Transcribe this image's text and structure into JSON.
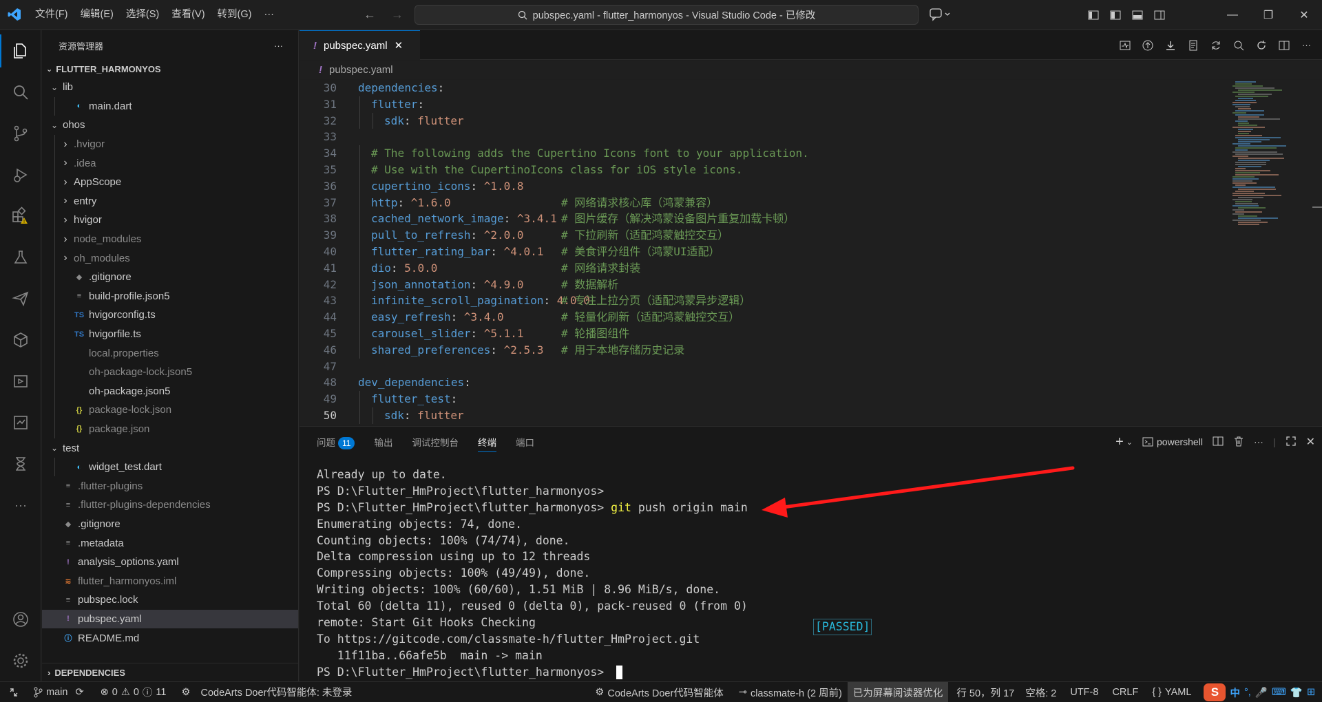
{
  "titlebar": {
    "menus": [
      "文件(F)",
      "编辑(E)",
      "选择(S)",
      "查看(V)",
      "转到(G)",
      "···"
    ],
    "search": "pubspec.yaml - flutter_harmonyos - Visual Studio Code - 已修改"
  },
  "sidebar": {
    "title": "资源管理器",
    "more": "···",
    "root": "FLUTTER_HARMONYOS",
    "items": [
      {
        "label": "lib",
        "depth": 0,
        "kind": "folder-open",
        "icon": ""
      },
      {
        "label": "main.dart",
        "depth": 1,
        "kind": "file",
        "icon": "dart"
      },
      {
        "label": "ohos",
        "depth": 0,
        "kind": "folder-open",
        "icon": ""
      },
      {
        "label": ".hvigor",
        "depth": 1,
        "kind": "folder",
        "icon": "",
        "dim": true
      },
      {
        "label": ".idea",
        "depth": 1,
        "kind": "folder",
        "icon": "",
        "dim": true
      },
      {
        "label": "AppScope",
        "depth": 1,
        "kind": "folder",
        "icon": ""
      },
      {
        "label": "entry",
        "depth": 1,
        "kind": "folder",
        "icon": ""
      },
      {
        "label": "hvigor",
        "depth": 1,
        "kind": "folder",
        "icon": ""
      },
      {
        "label": "node_modules",
        "depth": 1,
        "kind": "folder",
        "icon": "",
        "dim": true
      },
      {
        "label": "oh_modules",
        "depth": 1,
        "kind": "folder",
        "icon": "",
        "dim": true
      },
      {
        "label": ".gitignore",
        "depth": 1,
        "kind": "file",
        "icon": "git"
      },
      {
        "label": "build-profile.json5",
        "depth": 1,
        "kind": "file",
        "icon": "lines"
      },
      {
        "label": "hvigorconfig.ts",
        "depth": 1,
        "kind": "file",
        "icon": "ts"
      },
      {
        "label": "hvigorfile.ts",
        "depth": 1,
        "kind": "file",
        "icon": "ts"
      },
      {
        "label": "local.properties",
        "depth": 1,
        "kind": "file",
        "icon": "",
        "dim": true
      },
      {
        "label": "oh-package-lock.json5",
        "depth": 1,
        "kind": "file",
        "icon": "",
        "dim": true
      },
      {
        "label": "oh-package.json5",
        "depth": 1,
        "kind": "file",
        "icon": ""
      },
      {
        "label": "package-lock.json",
        "depth": 1,
        "kind": "file",
        "icon": "json",
        "dim": true
      },
      {
        "label": "package.json",
        "depth": 1,
        "kind": "file",
        "icon": "json",
        "dim": true
      },
      {
        "label": "test",
        "depth": 0,
        "kind": "folder-open",
        "icon": ""
      },
      {
        "label": "widget_test.dart",
        "depth": 1,
        "kind": "file",
        "icon": "dart"
      },
      {
        "label": ".flutter-plugins",
        "depth": 0,
        "kind": "file",
        "icon": "lines",
        "dim": true
      },
      {
        "label": ".flutter-plugins-dependencies",
        "depth": 0,
        "kind": "file",
        "icon": "lines",
        "dim": true
      },
      {
        "label": ".gitignore",
        "depth": 0,
        "kind": "file",
        "icon": "git"
      },
      {
        "label": ".metadata",
        "depth": 0,
        "kind": "file",
        "icon": "lines"
      },
      {
        "label": "analysis_options.yaml",
        "depth": 0,
        "kind": "file",
        "icon": "yaml"
      },
      {
        "label": "flutter_harmonyos.iml",
        "depth": 0,
        "kind": "file",
        "icon": "rss",
        "dim": true
      },
      {
        "label": "pubspec.lock",
        "depth": 0,
        "kind": "file",
        "icon": "lines"
      },
      {
        "label": "pubspec.yaml",
        "depth": 0,
        "kind": "file",
        "icon": "yaml",
        "selected": true
      },
      {
        "label": "README.md",
        "depth": 0,
        "kind": "file",
        "icon": "info"
      }
    ],
    "dependencies": "DEPENDENCIES"
  },
  "editor": {
    "tab": "pubspec.yaml",
    "breadcrumb": "pubspec.yaml",
    "lines": [
      {
        "n": "30",
        "indent": 0,
        "key": "dependencies",
        "val": "",
        "comment": ""
      },
      {
        "n": "31",
        "indent": 1,
        "key": "flutter",
        "val": "",
        "comment": ""
      },
      {
        "n": "32",
        "indent": 2,
        "key": "sdk",
        "val": "flutter",
        "comment": ""
      },
      {
        "n": "33",
        "indent": 0,
        "key": "",
        "val": "",
        "comment": ""
      },
      {
        "n": "34",
        "indent": 1,
        "key": "",
        "val": "",
        "comment": "# The following adds the Cupertino Icons font to your application."
      },
      {
        "n": "35",
        "indent": 1,
        "key": "",
        "val": "",
        "comment": "# Use with the CupertinoIcons class for iOS style icons."
      },
      {
        "n": "36",
        "indent": 1,
        "key": "cupertino_icons",
        "val": "^1.0.8",
        "comment": ""
      },
      {
        "n": "37",
        "indent": 1,
        "key": "http",
        "val": "^1.6.0",
        "comment": "# 网络请求核心库（鸿蒙兼容）"
      },
      {
        "n": "38",
        "indent": 1,
        "key": "cached_network_image",
        "val": "^3.4.1",
        "comment": "# 图片缓存（解决鸿蒙设备图片重复加载卡顿）"
      },
      {
        "n": "39",
        "indent": 1,
        "key": "pull_to_refresh",
        "val": "^2.0.0",
        "comment": "# 下拉刷新（适配鸿蒙触控交互）"
      },
      {
        "n": "40",
        "indent": 1,
        "key": "flutter_rating_bar",
        "val": "^4.0.1",
        "comment": "# 美食评分组件（鸿蒙UI适配）"
      },
      {
        "n": "41",
        "indent": 1,
        "key": "dio",
        "val": "5.0.0",
        "comment": "# 网络请求封装"
      },
      {
        "n": "42",
        "indent": 1,
        "key": "json_annotation",
        "val": "^4.9.0",
        "comment": "# 数据解析"
      },
      {
        "n": "43",
        "indent": 1,
        "key": "infinite_scroll_pagination",
        "val": "4.0.0",
        "comment": "# 专注上拉分页（适配鸿蒙异步逻辑）"
      },
      {
        "n": "44",
        "indent": 1,
        "key": "easy_refresh",
        "val": "^3.4.0",
        "comment": "# 轻量化刷新（适配鸿蒙触控交互）"
      },
      {
        "n": "45",
        "indent": 1,
        "key": "carousel_slider",
        "val": "^5.1.1",
        "comment": "# 轮播图组件"
      },
      {
        "n": "46",
        "indent": 1,
        "key": "shared_preferences",
        "val": "^2.5.3",
        "comment": "# 用于本地存储历史记录"
      },
      {
        "n": "47",
        "indent": 0,
        "key": "",
        "val": "",
        "comment": ""
      },
      {
        "n": "48",
        "indent": 0,
        "key": "dev_dependencies",
        "val": "",
        "comment": ""
      },
      {
        "n": "49",
        "indent": 1,
        "key": "flutter_test",
        "val": "",
        "comment": ""
      },
      {
        "n": "50",
        "indent": 2,
        "key": "sdk",
        "val": "flutter",
        "comment": ""
      }
    ]
  },
  "panel": {
    "tabs": [
      "问题",
      "输出",
      "调试控制台",
      "终端",
      "端口"
    ],
    "problems_count": "11",
    "active_tab": "终端",
    "shell": "powershell",
    "terminal": [
      {
        "text": "Already up to date.",
        "cmd": ""
      },
      {
        "text": "PS D:\\Flutter_HmProject\\flutter_harmonyos> ",
        "cmd": ""
      },
      {
        "text": "PS D:\\Flutter_HmProject\\flutter_harmonyos> ",
        "cmd": "git",
        "rest": " push origin main"
      },
      {
        "text": "Enumerating objects: 74, done.",
        "cmd": ""
      },
      {
        "text": "Counting objects: 100% (74/74), done.",
        "cmd": ""
      },
      {
        "text": "Delta compression using up to 12 threads",
        "cmd": ""
      },
      {
        "text": "Compressing objects: 100% (49/49), done.",
        "cmd": ""
      },
      {
        "text": "Writing objects: 100% (60/60), 1.51 MiB | 8.96 MiB/s, done.",
        "cmd": ""
      },
      {
        "text": "Total 60 (delta 11), reused 0 (delta 0), pack-reused 0 (from 0)",
        "cmd": ""
      },
      {
        "text": "remote: Start Git Hooks Checking",
        "cmd": ""
      },
      {
        "text": "To https://gitcode.com/classmate-h/flutter_HmProject.git",
        "cmd": ""
      },
      {
        "text": "   11f11ba..66afe5b  main -> main",
        "cmd": ""
      },
      {
        "text": "PS D:\\Flutter_HmProject\\flutter_harmonyos> ",
        "cmd": "",
        "cursor": true
      }
    ],
    "passed": "[PASSED]",
    "annotation_color": "#ff1a1a"
  },
  "statusbar": {
    "branch": "main",
    "errors": "0",
    "warnings": "0",
    "infos": "11",
    "codearts_left": "CodeArts Doer代码智能体: 未登录",
    "codearts_right": "CodeArts Doer代码智能体",
    "blame": "classmate-h (2 周前)",
    "screen_reader": "已为屏幕阅读器优化",
    "position": "行 50，列 17",
    "spaces": "空格: 2",
    "encoding": "UTF-8",
    "eol": "CRLF",
    "language": "YAML",
    "ime": [
      "中",
      "°,",
      "🎤",
      "⌨",
      "👕",
      "⊞"
    ]
  },
  "colors": {
    "accent": "#0078d4",
    "warning": "#cca700",
    "ime_brand": "#e8552f"
  }
}
